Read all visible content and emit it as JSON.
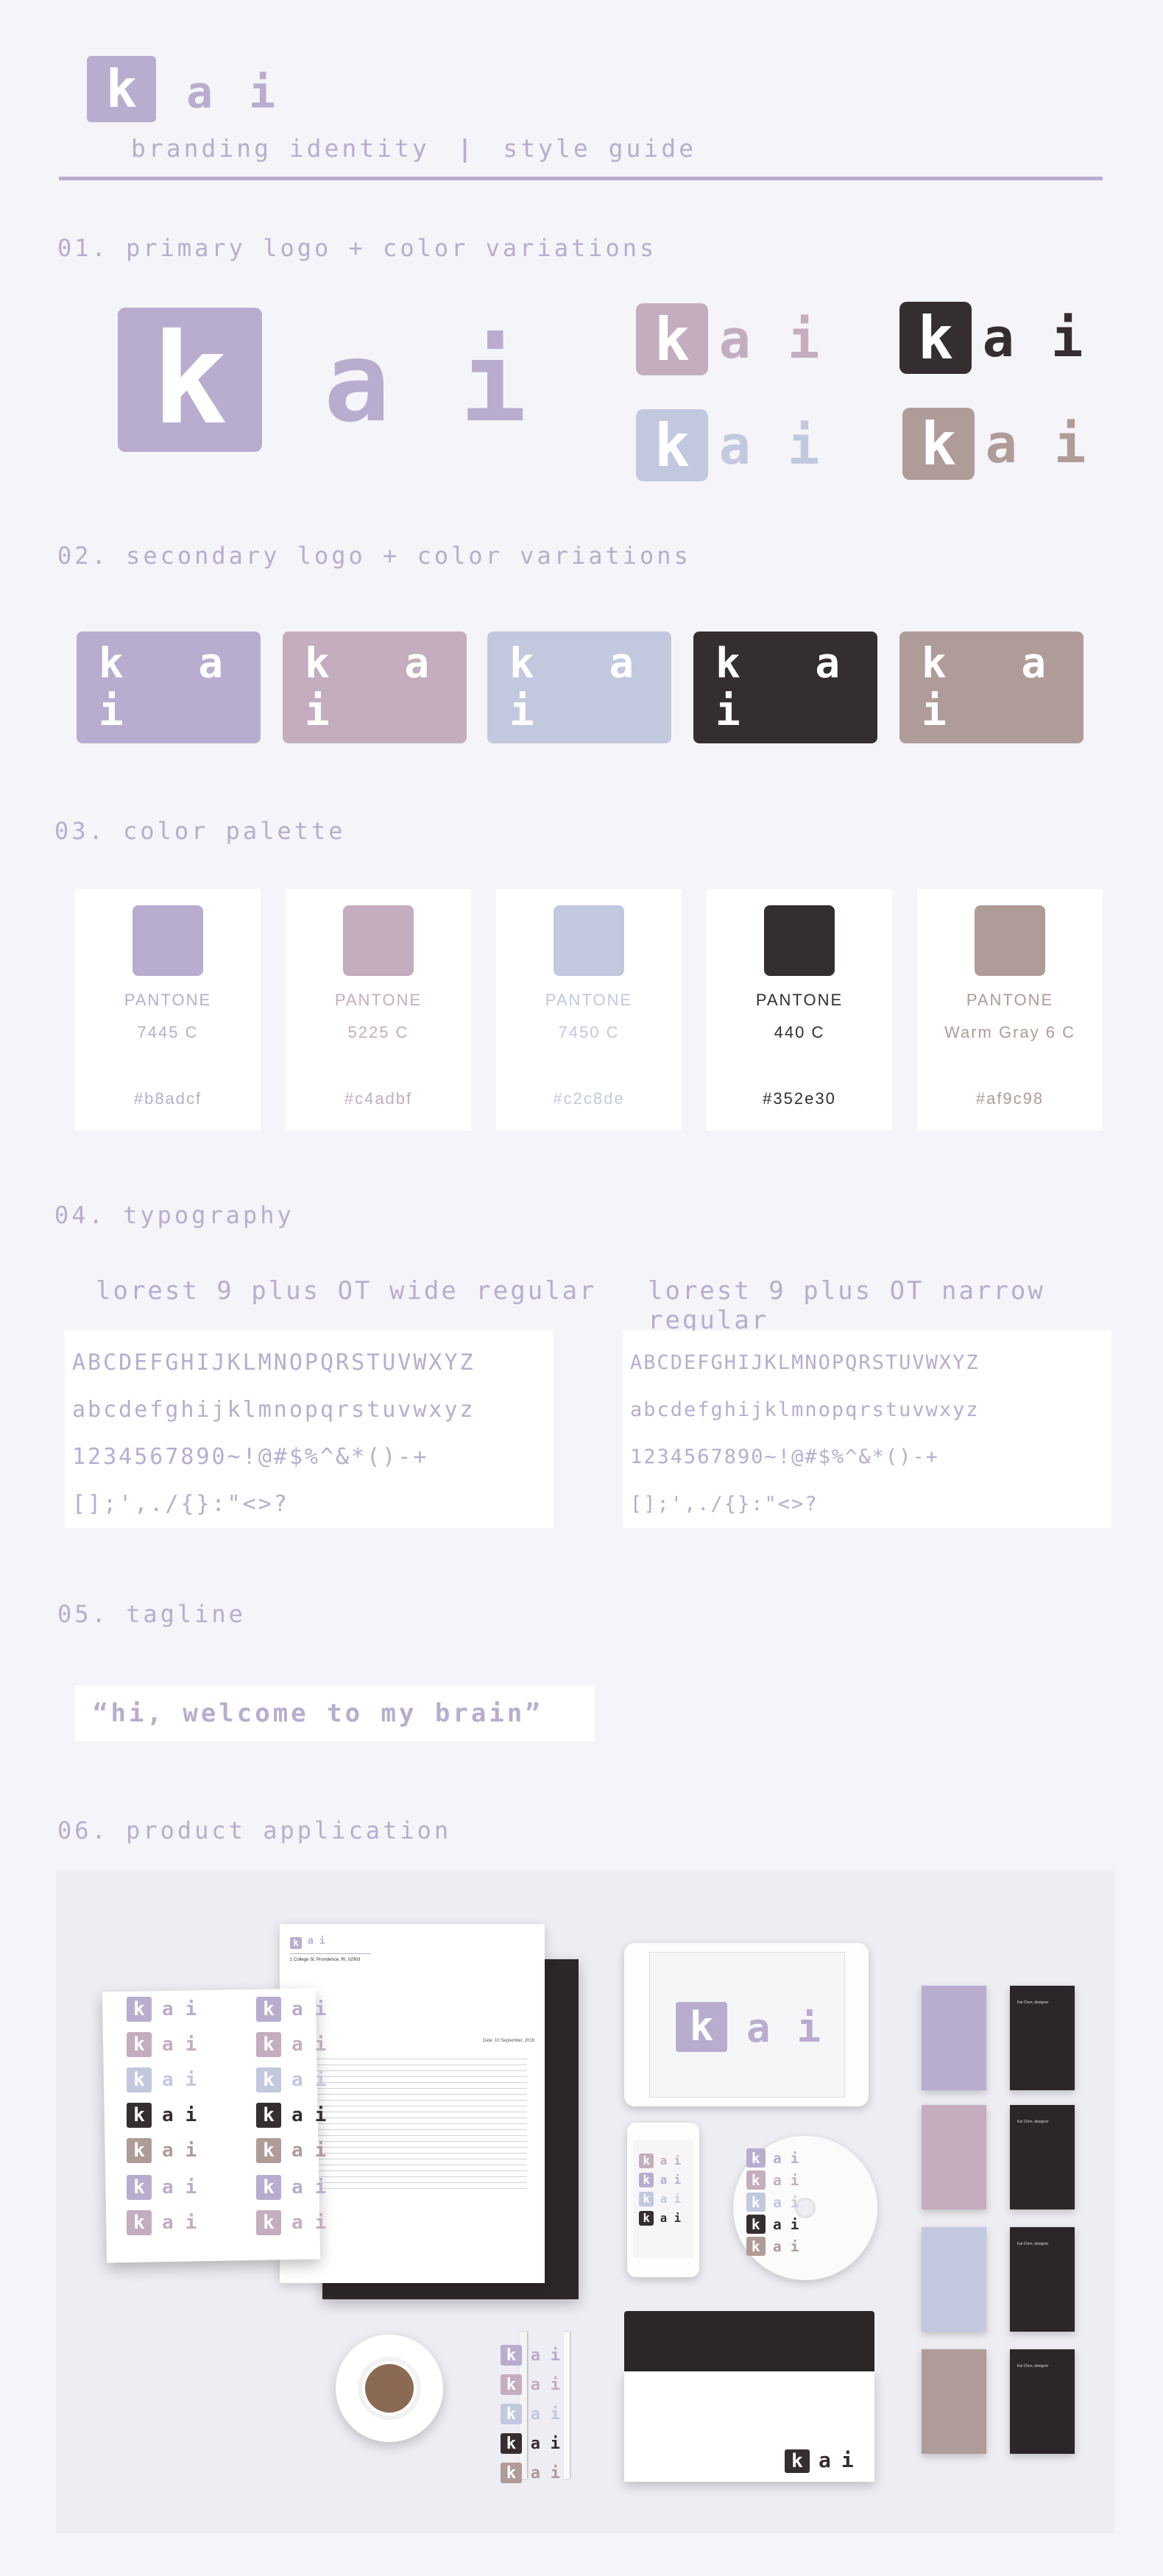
{
  "header": {
    "logo_k": "k",
    "logo_a": "a",
    "logo_i": "i",
    "subtitle_left": "branding identity",
    "subtitle_sep": "|",
    "subtitle_right": "style guide"
  },
  "sections": {
    "s1": "01. primary logo + color variations",
    "s2": "02. secondary logo + color variations",
    "s3": "03. color palette",
    "s4": "04. typography",
    "s5": "05. tagline",
    "s6": "06. product application"
  },
  "colors": {
    "lavender": "#b8adcf",
    "mauve": "#c4adbf",
    "periwinkle": "#c2c8de",
    "charcoal": "#352e30",
    "warmgray": "#af9c98"
  },
  "secondary_logo_text": "k a i",
  "palette": [
    {
      "p1": "PANTONE",
      "p2": "7445 C",
      "hex": "#b8adcf"
    },
    {
      "p1": "PANTONE",
      "p2": "5225 C",
      "hex": "#c4adbf"
    },
    {
      "p1": "PANTONE",
      "p2": "7450 C",
      "hex": "#c2c8de"
    },
    {
      "p1": "PANTONE",
      "p2": "440 C",
      "hex": "#352e30"
    },
    {
      "p1": "PANTONE",
      "p2": "Warm Gray 6 C",
      "hex": "#af9c98"
    }
  ],
  "typography": {
    "wide_title": "lorest 9 plus OT wide regular",
    "narrow_title": "lorest 9 plus OT narrow regular",
    "lines": [
      "ABCDEFGHIJKLMNOPQRSTUVWXYZ",
      "abcdefghijklmnopqrstuvwxyz",
      "1234567890~!@#$%^&*()-+",
      "[];',./{}:\"<>?"
    ]
  },
  "tagline": "“hi, welcome to my brain”",
  "mockup": {
    "letter_date": "Date: 10 September, 2019",
    "letter_addr": "1 College St, Providence, RI, 02903",
    "bc_name": "Kai Chen, designer"
  }
}
